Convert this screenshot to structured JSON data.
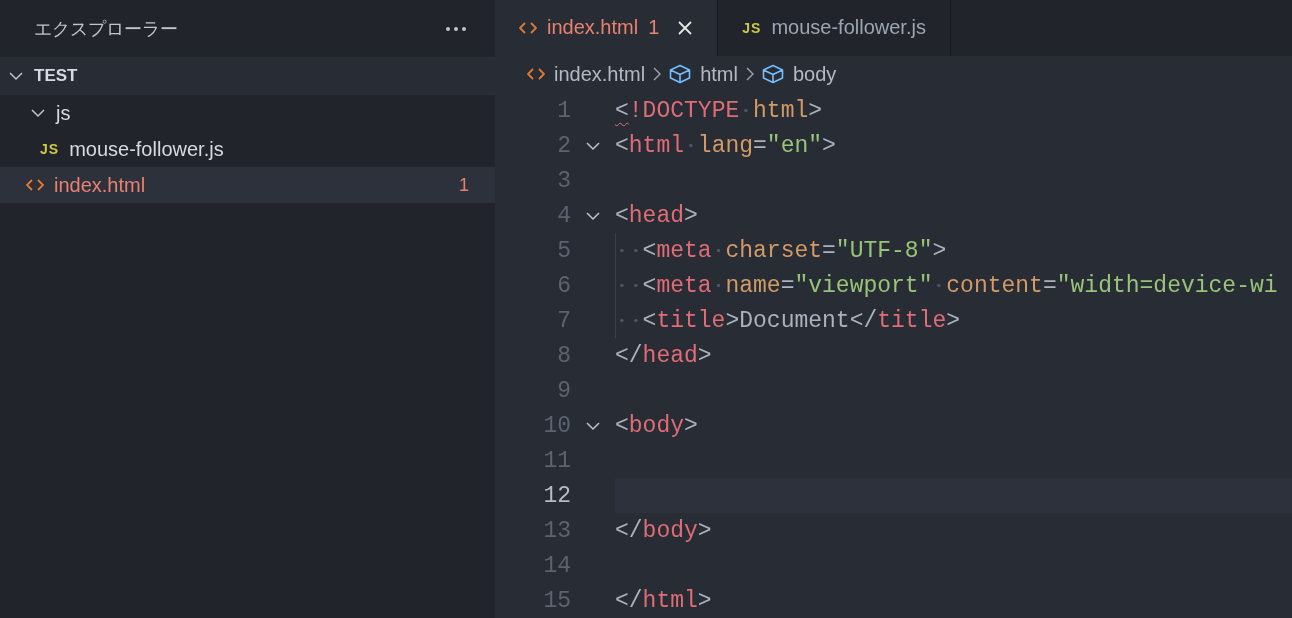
{
  "sidebar": {
    "title": "エクスプローラー",
    "root": {
      "label": "TEST",
      "expanded": true
    },
    "items": [
      {
        "label": "js",
        "kind": "folder",
        "expanded": true,
        "selected": false,
        "children": [
          {
            "label": "mouse-follower.js",
            "kind": "js",
            "selected": false,
            "icon_text": "JS"
          }
        ]
      },
      {
        "label": "index.html",
        "kind": "html",
        "selected": true,
        "badge": "1",
        "error": true
      }
    ]
  },
  "tabs": [
    {
      "label": "index.html",
      "kind": "html",
      "badge": "1",
      "selected": true,
      "error": true
    },
    {
      "label": "mouse-follower.js",
      "kind": "js",
      "icon_text": "JS",
      "selected": false
    }
  ],
  "breadcrumb": [
    {
      "label": "index.html",
      "kind": "html"
    },
    {
      "label": "html",
      "kind": "element"
    },
    {
      "label": "body",
      "kind": "element"
    }
  ],
  "editor": {
    "lines": [
      {
        "number": "1",
        "current": false,
        "tokens": [
          {
            "kind": "punct",
            "text": "<",
            "error": true
          },
          {
            "kind": "tag",
            "text": "!DOCTYPE"
          },
          {
            "kind": "ws"
          },
          {
            "kind": "attr",
            "text": "html"
          },
          {
            "kind": "punct",
            "text": ">"
          }
        ]
      },
      {
        "number": "2",
        "current": false,
        "expanded": true,
        "tokens": [
          {
            "kind": "punct",
            "text": "<"
          },
          {
            "kind": "tag",
            "text": "html"
          },
          {
            "kind": "ws"
          },
          {
            "kind": "attr",
            "text": "lang"
          },
          {
            "kind": "punct",
            "text": "="
          },
          {
            "kind": "string",
            "text": "\"en\""
          },
          {
            "kind": "punct",
            "text": ">"
          }
        ]
      },
      {
        "number": "3",
        "current": false
      },
      {
        "number": "4",
        "current": false,
        "expanded": true,
        "tokens": [
          {
            "kind": "punct",
            "text": "<"
          },
          {
            "kind": "tag",
            "text": "head"
          },
          {
            "kind": "punct",
            "text": ">"
          }
        ]
      },
      {
        "number": "5",
        "current": false,
        "guide": true,
        "tokens": [
          {
            "kind": "ws"
          },
          {
            "kind": "ws"
          },
          {
            "kind": "punct",
            "text": "<"
          },
          {
            "kind": "tag",
            "text": "meta"
          },
          {
            "kind": "ws"
          },
          {
            "kind": "attr",
            "text": "charset"
          },
          {
            "kind": "punct",
            "text": "="
          },
          {
            "kind": "string",
            "text": "\"UTF-8\""
          },
          {
            "kind": "punct",
            "text": ">"
          }
        ]
      },
      {
        "number": "6",
        "current": false,
        "guide": true,
        "tokens": [
          {
            "kind": "ws"
          },
          {
            "kind": "ws"
          },
          {
            "kind": "punct",
            "text": "<"
          },
          {
            "kind": "tag",
            "text": "meta"
          },
          {
            "kind": "ws"
          },
          {
            "kind": "attr",
            "text": "name"
          },
          {
            "kind": "punct",
            "text": "="
          },
          {
            "kind": "string",
            "text": "\"viewport\""
          },
          {
            "kind": "ws"
          },
          {
            "kind": "attr",
            "text": "content"
          },
          {
            "kind": "punct",
            "text": "="
          },
          {
            "kind": "string",
            "text": "\"width=device-wi"
          }
        ]
      },
      {
        "number": "7",
        "current": false,
        "guide": true,
        "tokens": [
          {
            "kind": "ws"
          },
          {
            "kind": "ws"
          },
          {
            "kind": "punct",
            "text": "<"
          },
          {
            "kind": "tag",
            "text": "title"
          },
          {
            "kind": "punct",
            "text": ">"
          },
          {
            "kind": "text",
            "text": "Document"
          },
          {
            "kind": "punct",
            "text": "</"
          },
          {
            "kind": "tag",
            "text": "title"
          },
          {
            "kind": "punct",
            "text": ">"
          }
        ]
      },
      {
        "number": "8",
        "current": false,
        "tokens": [
          {
            "kind": "punct",
            "text": "</"
          },
          {
            "kind": "tag",
            "text": "head"
          },
          {
            "kind": "punct",
            "text": ">"
          }
        ]
      },
      {
        "number": "9",
        "current": false
      },
      {
        "number": "10",
        "current": false,
        "expanded": true,
        "tokens": [
          {
            "kind": "punct",
            "text": "<"
          },
          {
            "kind": "tag",
            "text": "body"
          },
          {
            "kind": "punct",
            "text": ">"
          }
        ]
      },
      {
        "number": "11",
        "current": false
      },
      {
        "number": "12",
        "current": true
      },
      {
        "number": "13",
        "current": false,
        "tokens": [
          {
            "kind": "punct",
            "text": "</"
          },
          {
            "kind": "tag",
            "text": "body"
          },
          {
            "kind": "punct",
            "text": ">"
          }
        ]
      },
      {
        "number": "14",
        "current": false
      },
      {
        "number": "15",
        "current": false,
        "tokens": [
          {
            "kind": "punct",
            "text": "</"
          },
          {
            "kind": "tag",
            "text": "html"
          },
          {
            "kind": "punct",
            "text": ">"
          }
        ]
      }
    ]
  }
}
